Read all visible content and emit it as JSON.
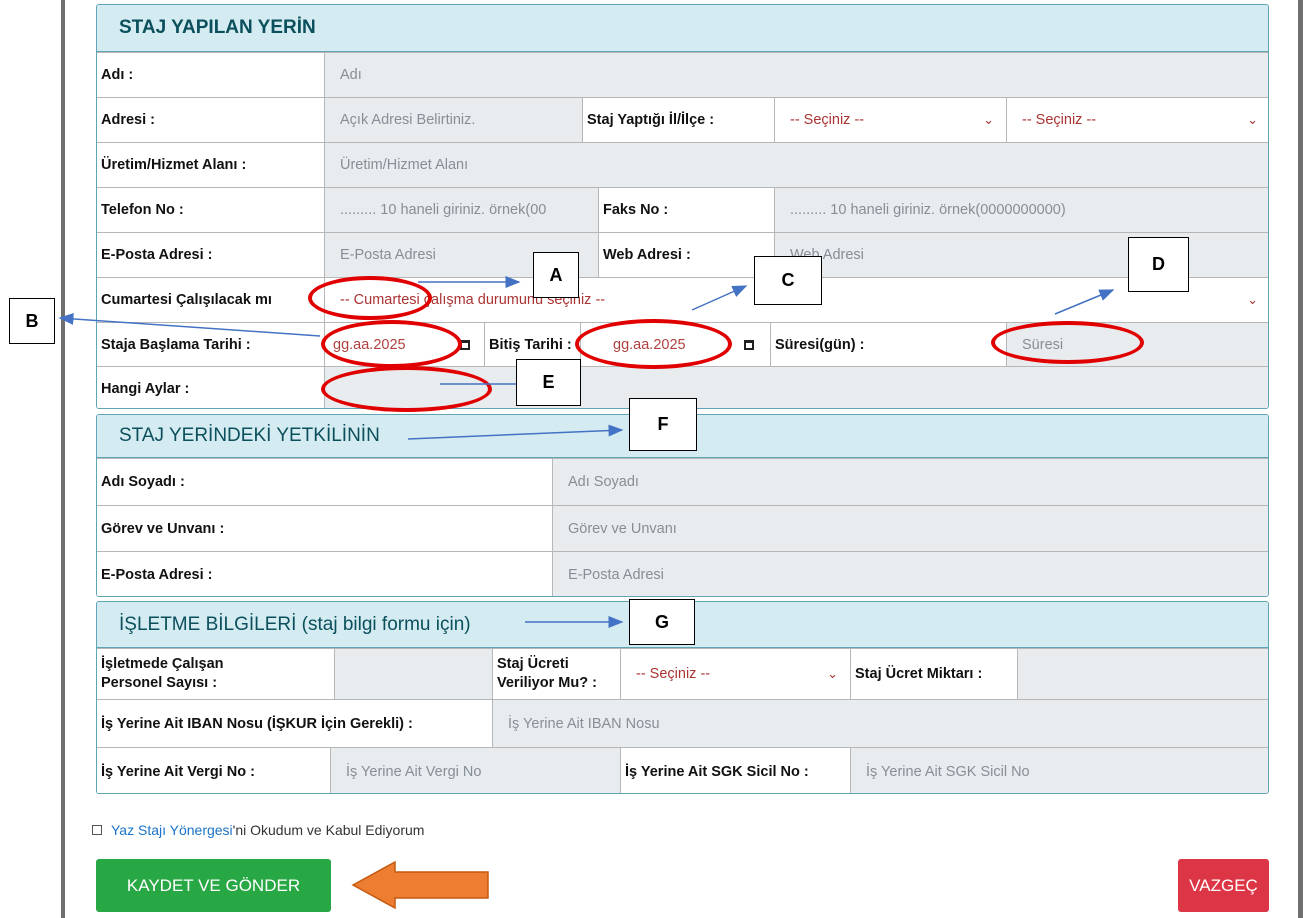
{
  "section1": {
    "title": "STAJ YAPILAN YERİN",
    "ad_label": "Adı :",
    "ad_placeholder": "Adı",
    "adres_label": "Adresi :",
    "adres_placeholder": "Açık Adresi Belirtiniz.",
    "il_ilce_label": "Staj Yaptığı İl/İlçe :",
    "il_value": "-- Seçiniz --",
    "ilce_value": "-- Seçiniz --",
    "uretim_label": "Üretim/Hizmet Alanı :",
    "uretim_placeholder": "Üretim/Hizmet Alanı",
    "telefon_label": "Telefon No :",
    "telefon_placeholder": "......... 10 haneli giriniz. örnek(00",
    "faks_label": "Faks No :",
    "faks_placeholder": "......... 10 haneli giriniz. örnek(0000000000)",
    "eposta_label": "E-Posta Adresi :",
    "eposta_placeholder": "E-Posta Adresi",
    "web_label": "Web Adresi :",
    "web_placeholder": "Web Adresi",
    "cumartesi_label": "Cumartesi Çalışılacak mı",
    "cumartesi_value": "-- Cumartesi çalışma durumunu seçiniz --",
    "baslama_label": "Staja Başlama Tarihi :",
    "baslama_value": "gg.aa.2025",
    "bitis_label": "Bitiş Tarihi :",
    "bitis_value": "gg.aa.2025",
    "suresi_label": "Süresi(gün) :",
    "suresi_placeholder": "Süresi",
    "aylar_label": "Hangi Aylar :"
  },
  "section2": {
    "title": "STAJ YERİNDEKİ YETKİLİNİN",
    "adsoyad_label": "Adı Soyadı :",
    "adsoyad_placeholder": "Adı Soyadı",
    "gorev_label": "Görev ve Unvanı :",
    "gorev_placeholder": "Görev ve Unvanı",
    "eposta_label": "E-Posta Adresi :",
    "eposta_placeholder": "E-Posta Adresi"
  },
  "section3": {
    "title": "İŞLETME BİLGİLERİ (staj bilgi formu için)",
    "personel_label_1": "İşletmede Çalışan",
    "personel_label_2": "Personel Sayısı :",
    "ucret_verilen_label_1": "Staj Ücreti",
    "ucret_verilen_label_2": "Veriliyor Mu? :",
    "ucret_verilen_value": "-- Seçiniz --",
    "ucret_miktar_label": "Staj Ücret Miktarı :",
    "iban_label": "İş Yerine Ait IBAN Nosu (İŞKUR İçin Gerekli) :",
    "iban_placeholder": "İş Yerine Ait IBAN Nosu",
    "vergi_label": "İş Yerine Ait Vergi No :",
    "vergi_placeholder": "İş Yerine Ait Vergi No",
    "sgk_label": "İş Yerine Ait SGK Sicil No :",
    "sgk_placeholder": "İş Yerine Ait SGK Sicil No"
  },
  "agreement": {
    "link_text": "Yaz Stajı Yönergesi",
    "rest_text": "'ni Okudum ve Kabul Ediyorum"
  },
  "buttons": {
    "save": "KAYDET VE GÖNDER",
    "cancel": "VAZGEÇ"
  },
  "annotations": {
    "A": "A",
    "B": "B",
    "C": "C",
    "D": "D",
    "E": "E",
    "F": "F",
    "G": "G"
  },
  "colors": {
    "header_bg": "#d4ecf1",
    "header_text": "#0b4f5c",
    "input_bg": "#e9ecef",
    "select_text": "#a33333",
    "save_button": "#28a745",
    "cancel_button": "#dc3545",
    "annotation_red": "#e00000",
    "annotation_arrow": "#4472c4",
    "big_arrow": "#ed7d31"
  },
  "icons": {
    "select_chevron": "chevron-down-icon",
    "date_picker": "calendar-icon"
  }
}
